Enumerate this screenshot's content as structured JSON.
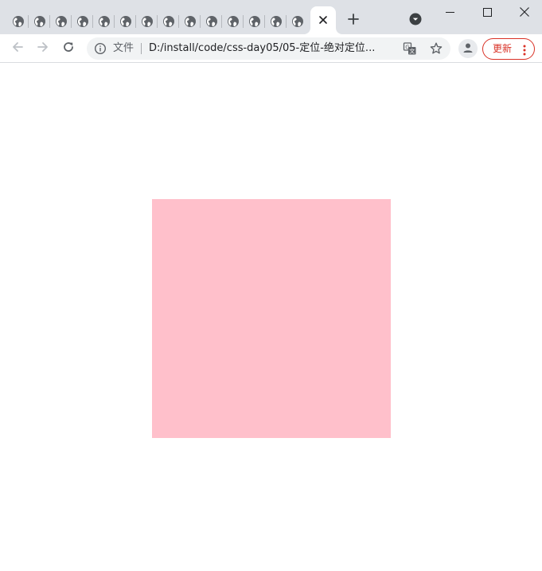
{
  "tabs": {
    "count_minimized": 14,
    "favicon": "globe-icon",
    "active_close": "close-icon",
    "new_tab": "plus-icon",
    "tab_search": "chevron-down-icon"
  },
  "window": {
    "minimize": "minimize-icon",
    "maximize": "maximize-icon",
    "close": "close-icon"
  },
  "toolbar": {
    "back": "arrow-left-icon",
    "forward": "arrow-right-icon",
    "reload": "reload-icon",
    "omnibox": {
      "info_icon": "info-icon",
      "chip_label": "文件",
      "url": "D:/install/code/css-day05/05-定位-绝对定位...",
      "translate_icon": "translate-icon",
      "bookmark_icon": "star-icon"
    },
    "profile_icon": "person-icon",
    "update_label": "更新",
    "menu_icon": "more-vert-icon"
  },
  "colors": {
    "tabstrip_bg": "#dee1e6",
    "omnibox_bg": "#f1f3f4",
    "update_accent": "#d93025",
    "box_fill": "#ffc0cb"
  },
  "page": {
    "box": {
      "color": "#ffc0cb"
    }
  }
}
